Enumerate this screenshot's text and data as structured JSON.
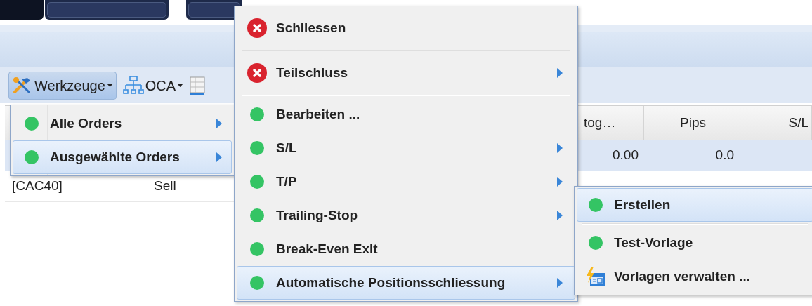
{
  "toolbar": [
    {
      "label": "Werkzeuge",
      "kind": "tools",
      "pressed": true
    },
    {
      "label": "OCA",
      "kind": "oca",
      "pressed": false
    }
  ],
  "table": {
    "columns": [
      "tog…",
      "Pips",
      "S/L"
    ],
    "rows": [
      {
        "selected": true,
        "value": "0.00",
        "pips": "0.0"
      },
      {
        "selected": false,
        "symbol": "[CAC40]",
        "side": "Sell"
      }
    ]
  },
  "left_menu": [
    {
      "label": "Alle Orders",
      "kind": "dot",
      "selected": false,
      "submenu": true
    },
    {
      "label": "Ausgewählte Orders",
      "kind": "dot",
      "selected": true,
      "submenu": true
    }
  ],
  "main_menu": [
    [
      {
        "label": "Schliessen",
        "kind": "close",
        "selected": false,
        "submenu": false
      }
    ],
    [
      {
        "label": "Teilschluss",
        "kind": "close",
        "selected": false,
        "submenu": true
      }
    ],
    [
      {
        "label": "Bearbeiten ...",
        "kind": "dot",
        "selected": false,
        "submenu": false
      },
      {
        "label": "S/L",
        "kind": "dot",
        "selected": false,
        "submenu": true
      },
      {
        "label": "T/P",
        "kind": "dot",
        "selected": false,
        "submenu": true
      },
      {
        "label": "Trailing-Stop",
        "kind": "dot",
        "selected": false,
        "submenu": true
      },
      {
        "label": "Break-Even Exit",
        "kind": "dot",
        "selected": false,
        "submenu": false
      },
      {
        "label": "Automatische Positionsschliessung",
        "kind": "dot",
        "selected": true,
        "submenu": true
      }
    ]
  ],
  "sub_menu": [
    [
      {
        "label": "Erstellen",
        "kind": "dot",
        "selected": true,
        "submenu": false
      }
    ],
    [
      {
        "label": "Test-Vorlage",
        "kind": "dot",
        "selected": false,
        "submenu": false
      },
      {
        "label": "Vorlagen verwalten ...",
        "kind": "templates",
        "selected": false,
        "submenu": false
      }
    ]
  ]
}
